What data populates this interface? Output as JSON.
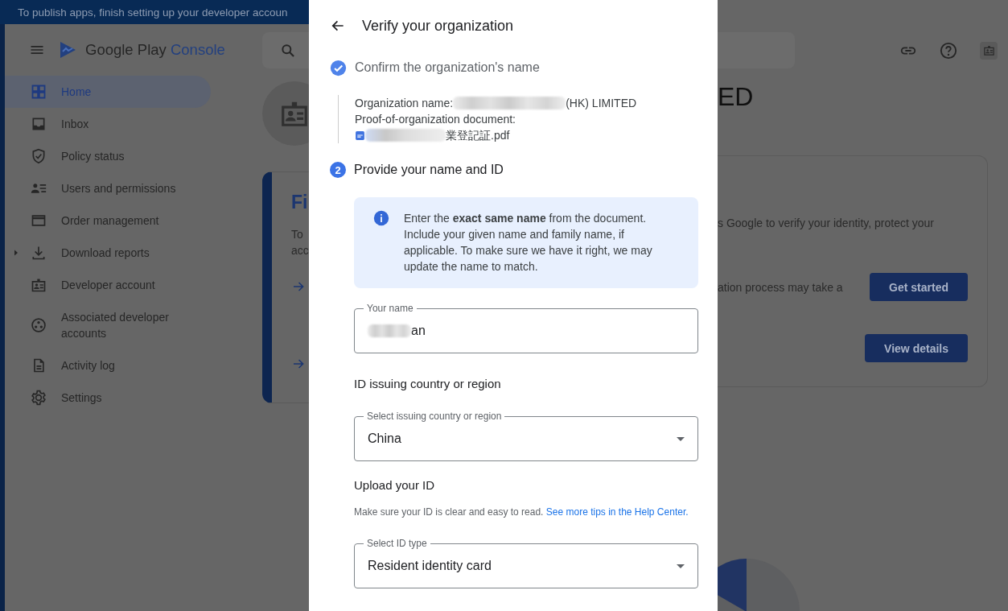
{
  "banner": {
    "text": "To publish apps, finish setting up your developer accoun"
  },
  "app_bar": {
    "product_name": "Google Play",
    "product_suffix": "Console"
  },
  "sidebar": {
    "items": [
      {
        "label": "Home",
        "selected": true,
        "expandable": false
      },
      {
        "label": "Inbox",
        "selected": false,
        "expandable": false
      },
      {
        "label": "Policy status",
        "selected": false,
        "expandable": false
      },
      {
        "label": "Users and permissions",
        "selected": false,
        "expandable": false
      },
      {
        "label": "Order management",
        "selected": false,
        "expandable": false
      },
      {
        "label": "Download reports",
        "selected": false,
        "expandable": true
      },
      {
        "label": "Developer account",
        "selected": false,
        "expandable": false
      },
      {
        "label": "Associated developer accounts",
        "selected": false,
        "expandable": false
      },
      {
        "label": "Activity log",
        "selected": false,
        "expandable": false
      },
      {
        "label": "Settings",
        "selected": false,
        "expandable": false
      }
    ]
  },
  "page": {
    "heading_fragment": "ED",
    "card": {
      "title_fragment": "Fi",
      "left_fragments": [
        "To",
        "acc"
      ],
      "right_fragments": [
        "s Google to verify your identity, protect your",
        "ation process may take a"
      ],
      "buttons": [
        "Get started",
        "View details"
      ]
    }
  },
  "dialog": {
    "title": "Verify your organization",
    "steps": [
      {
        "kind": "done",
        "title": "Confirm the organization's name"
      },
      {
        "kind": "current",
        "number": "2",
        "title": "Provide your name and ID"
      }
    ],
    "organization": {
      "name_label": "Organization name:",
      "name_visible": "(HK) LIMITED",
      "document_label": "Proof-of-organization document:",
      "file_name_visible": "業登記証.pdf"
    },
    "info": "Enter the **exact same name** from the document. Include your given name and family name, if applicable. To make sure we have it right, we may update the name to match.",
    "name_field": {
      "label": "Your name",
      "value": "an"
    },
    "country_heading": "ID issuing country or region",
    "country_select": {
      "label": "Select issuing country or region",
      "value": "China"
    },
    "upload_heading": "Upload your ID",
    "upload_help": {
      "text": "Make sure your ID is clear and easy to read.",
      "link": "See more tips in the Help Center."
    },
    "id_type_select": {
      "label": "Select ID type",
      "value": "Resident identity card"
    }
  }
}
